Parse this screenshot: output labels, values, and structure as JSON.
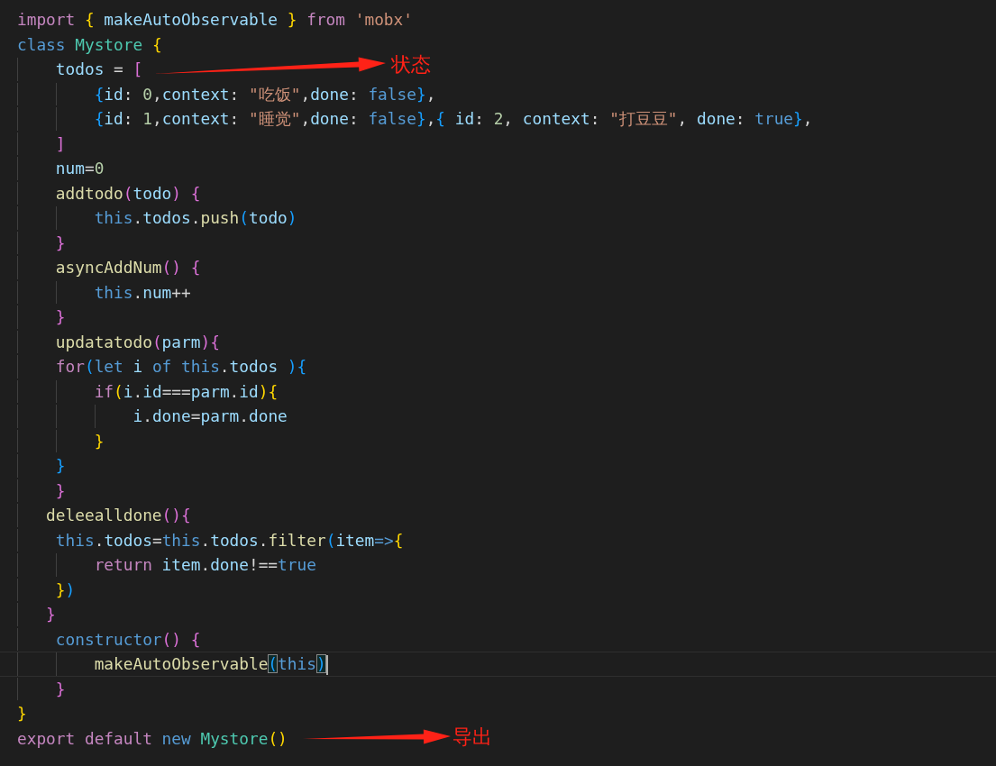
{
  "code_lines": [
    {
      "current": false,
      "tokens": [
        {
          "text": "import ",
          "kind": "kw"
        },
        {
          "text": "{",
          "kind": "b1"
        },
        {
          "text": " makeAutoObservable ",
          "kind": "var"
        },
        {
          "text": "}",
          "kind": "b1"
        },
        {
          "text": " from",
          "kind": "kw"
        },
        {
          "text": " 'mobx'",
          "kind": "str"
        }
      ]
    },
    {
      "current": false,
      "tokens": [
        {
          "text": "class",
          "kind": "st"
        },
        {
          "text": " Mystore",
          "kind": "cls"
        },
        {
          "text": " {",
          "kind": "b1"
        }
      ]
    },
    {
      "current": false,
      "tokens": [
        {
          "text": "    todos",
          "kind": "var"
        },
        {
          "text": " = ",
          "kind": "p"
        },
        {
          "text": "[",
          "kind": "b2"
        }
      ]
    },
    {
      "current": false,
      "tokens": [
        {
          "text": "        {",
          "kind": "b3"
        },
        {
          "text": "id",
          "kind": "var"
        },
        {
          "text": ": ",
          "kind": "p"
        },
        {
          "text": "0",
          "kind": "num"
        },
        {
          "text": ",",
          "kind": "p"
        },
        {
          "text": "context",
          "kind": "var"
        },
        {
          "text": ": ",
          "kind": "p"
        },
        {
          "text": "\"吃饭\"",
          "kind": "str"
        },
        {
          "text": ",",
          "kind": "p"
        },
        {
          "text": "done",
          "kind": "var"
        },
        {
          "text": ": ",
          "kind": "p"
        },
        {
          "text": "false",
          "kind": "st"
        },
        {
          "text": "}",
          "kind": "b3"
        },
        {
          "text": ",",
          "kind": "p"
        }
      ]
    },
    {
      "current": false,
      "tokens": [
        {
          "text": "        {",
          "kind": "b3"
        },
        {
          "text": "id",
          "kind": "var"
        },
        {
          "text": ": ",
          "kind": "p"
        },
        {
          "text": "1",
          "kind": "num"
        },
        {
          "text": ",",
          "kind": "p"
        },
        {
          "text": "context",
          "kind": "var"
        },
        {
          "text": ": ",
          "kind": "p"
        },
        {
          "text": "\"睡觉\"",
          "kind": "str"
        },
        {
          "text": ",",
          "kind": "p"
        },
        {
          "text": "done",
          "kind": "var"
        },
        {
          "text": ": ",
          "kind": "p"
        },
        {
          "text": "false",
          "kind": "st"
        },
        {
          "text": "}",
          "kind": "b3"
        },
        {
          "text": ",",
          "kind": "p"
        },
        {
          "text": "{",
          "kind": "b3"
        },
        {
          "text": " id",
          "kind": "var"
        },
        {
          "text": ": ",
          "kind": "p"
        },
        {
          "text": "2",
          "kind": "num"
        },
        {
          "text": ", ",
          "kind": "p"
        },
        {
          "text": "context",
          "kind": "var"
        },
        {
          "text": ": ",
          "kind": "p"
        },
        {
          "text": "\"打豆豆\"",
          "kind": "str"
        },
        {
          "text": ", ",
          "kind": "p"
        },
        {
          "text": "done",
          "kind": "var"
        },
        {
          "text": ": ",
          "kind": "p"
        },
        {
          "text": "true",
          "kind": "st"
        },
        {
          "text": "}",
          "kind": "b3"
        },
        {
          "text": ",",
          "kind": "p"
        }
      ]
    },
    {
      "current": false,
      "tokens": [
        {
          "text": "    ]",
          "kind": "b2"
        }
      ]
    },
    {
      "current": false,
      "tokens": [
        {
          "text": "    num",
          "kind": "var"
        },
        {
          "text": "=",
          "kind": "p"
        },
        {
          "text": "0",
          "kind": "num"
        }
      ]
    },
    {
      "current": false,
      "tokens": [
        {
          "text": "    addtodo",
          "kind": "fn"
        },
        {
          "text": "(",
          "kind": "b2"
        },
        {
          "text": "todo",
          "kind": "var"
        },
        {
          "text": ") {",
          "kind": "b2"
        }
      ]
    },
    {
      "current": false,
      "tokens": [
        {
          "text": "        this",
          "kind": "st"
        },
        {
          "text": ".",
          "kind": "p"
        },
        {
          "text": "todos",
          "kind": "var"
        },
        {
          "text": ".",
          "kind": "p"
        },
        {
          "text": "push",
          "kind": "fn"
        },
        {
          "text": "(",
          "kind": "b3"
        },
        {
          "text": "todo",
          "kind": "var"
        },
        {
          "text": ")",
          "kind": "b3"
        }
      ]
    },
    {
      "current": false,
      "tokens": [
        {
          "text": "    }",
          "kind": "b2"
        }
      ]
    },
    {
      "current": false,
      "tokens": [
        {
          "text": "    asyncAddNum",
          "kind": "fn"
        },
        {
          "text": "()",
          "kind": "b2"
        },
        {
          "text": " {",
          "kind": "b2"
        }
      ]
    },
    {
      "current": false,
      "tokens": [
        {
          "text": "        this",
          "kind": "st"
        },
        {
          "text": ".",
          "kind": "p"
        },
        {
          "text": "num",
          "kind": "var"
        },
        {
          "text": "++",
          "kind": "p"
        }
      ]
    },
    {
      "current": false,
      "tokens": [
        {
          "text": "    }",
          "kind": "b2"
        }
      ]
    },
    {
      "current": false,
      "tokens": [
        {
          "text": "    updatatodo",
          "kind": "fn"
        },
        {
          "text": "(",
          "kind": "b2"
        },
        {
          "text": "parm",
          "kind": "var"
        },
        {
          "text": ")",
          "kind": "b2"
        },
        {
          "text": "{",
          "kind": "b2"
        }
      ]
    },
    {
      "current": false,
      "tokens": [
        {
          "text": "    for",
          "kind": "kw"
        },
        {
          "text": "(",
          "kind": "b3"
        },
        {
          "text": "let",
          "kind": "st"
        },
        {
          "text": " i",
          "kind": "var"
        },
        {
          "text": " of",
          "kind": "st"
        },
        {
          "text": " this",
          "kind": "st"
        },
        {
          "text": ".",
          "kind": "p"
        },
        {
          "text": "todos",
          "kind": "var"
        },
        {
          "text": " )",
          "kind": "b3"
        },
        {
          "text": "{",
          "kind": "b3"
        }
      ]
    },
    {
      "current": false,
      "tokens": [
        {
          "text": "        if",
          "kind": "kw"
        },
        {
          "text": "(",
          "kind": "b1"
        },
        {
          "text": "i",
          "kind": "var"
        },
        {
          "text": ".",
          "kind": "p"
        },
        {
          "text": "id",
          "kind": "var"
        },
        {
          "text": "===",
          "kind": "p"
        },
        {
          "text": "parm",
          "kind": "var"
        },
        {
          "text": ".",
          "kind": "p"
        },
        {
          "text": "id",
          "kind": "var"
        },
        {
          "text": ")",
          "kind": "b1"
        },
        {
          "text": "{",
          "kind": "b1"
        }
      ]
    },
    {
      "current": false,
      "tokens": [
        {
          "text": "            i",
          "kind": "var"
        },
        {
          "text": ".",
          "kind": "p"
        },
        {
          "text": "done",
          "kind": "var"
        },
        {
          "text": "=",
          "kind": "p"
        },
        {
          "text": "parm",
          "kind": "var"
        },
        {
          "text": ".",
          "kind": "p"
        },
        {
          "text": "done",
          "kind": "var"
        }
      ]
    },
    {
      "current": false,
      "tokens": [
        {
          "text": "        }",
          "kind": "b1"
        }
      ]
    },
    {
      "current": false,
      "tokens": [
        {
          "text": "    }",
          "kind": "b3"
        }
      ]
    },
    {
      "current": false,
      "tokens": [
        {
          "text": "    }",
          "kind": "b2"
        }
      ]
    },
    {
      "current": false,
      "tokens": [
        {
          "text": "   deleealldone",
          "kind": "fn"
        },
        {
          "text": "()",
          "kind": "b2"
        },
        {
          "text": "{",
          "kind": "b2"
        }
      ]
    },
    {
      "current": false,
      "tokens": [
        {
          "text": "    this",
          "kind": "st"
        },
        {
          "text": ".",
          "kind": "p"
        },
        {
          "text": "todos",
          "kind": "var"
        },
        {
          "text": "=",
          "kind": "p"
        },
        {
          "text": "this",
          "kind": "st"
        },
        {
          "text": ".",
          "kind": "p"
        },
        {
          "text": "todos",
          "kind": "var"
        },
        {
          "text": ".",
          "kind": "p"
        },
        {
          "text": "filter",
          "kind": "fn"
        },
        {
          "text": "(",
          "kind": "b3"
        },
        {
          "text": "item",
          "kind": "var"
        },
        {
          "text": "=>",
          "kind": "st"
        },
        {
          "text": "{",
          "kind": "b1"
        }
      ]
    },
    {
      "current": false,
      "tokens": [
        {
          "text": "        return",
          "kind": "kw"
        },
        {
          "text": " item",
          "kind": "var"
        },
        {
          "text": ".",
          "kind": "p"
        },
        {
          "text": "done",
          "kind": "var"
        },
        {
          "text": "!==",
          "kind": "p"
        },
        {
          "text": "true",
          "kind": "st"
        }
      ]
    },
    {
      "current": false,
      "tokens": [
        {
          "text": "    }",
          "kind": "b1"
        },
        {
          "text": ")",
          "kind": "b3"
        }
      ]
    },
    {
      "current": false,
      "tokens": [
        {
          "text": "   }",
          "kind": "b2"
        }
      ]
    },
    {
      "current": false,
      "tokens": [
        {
          "text": "    constructor",
          "kind": "st"
        },
        {
          "text": "()",
          "kind": "b2"
        },
        {
          "text": " {",
          "kind": "b2"
        }
      ]
    },
    {
      "current": true,
      "tokens": [
        {
          "text": "        makeAutoObservable",
          "kind": "fn"
        },
        {
          "text": "(",
          "kind": "bm"
        },
        {
          "text": "this",
          "kind": "st"
        },
        {
          "text": ")",
          "kind": "bm"
        }
      ]
    },
    {
      "current": false,
      "tokens": [
        {
          "text": "    }",
          "kind": "b2"
        }
      ]
    },
    {
      "current": false,
      "tokens": [
        {
          "text": "}",
          "kind": "b1"
        }
      ]
    },
    {
      "current": false,
      "tokens": [
        {
          "text": "export",
          "kind": "kw"
        },
        {
          "text": " default",
          "kind": "kw"
        },
        {
          "text": " new",
          "kind": "st"
        },
        {
          "text": " Mystore",
          "kind": "cls"
        },
        {
          "text": "()",
          "kind": "b1"
        }
      ]
    }
  ],
  "annotations": [
    {
      "label": "状态"
    },
    {
      "label": "导出"
    }
  ]
}
